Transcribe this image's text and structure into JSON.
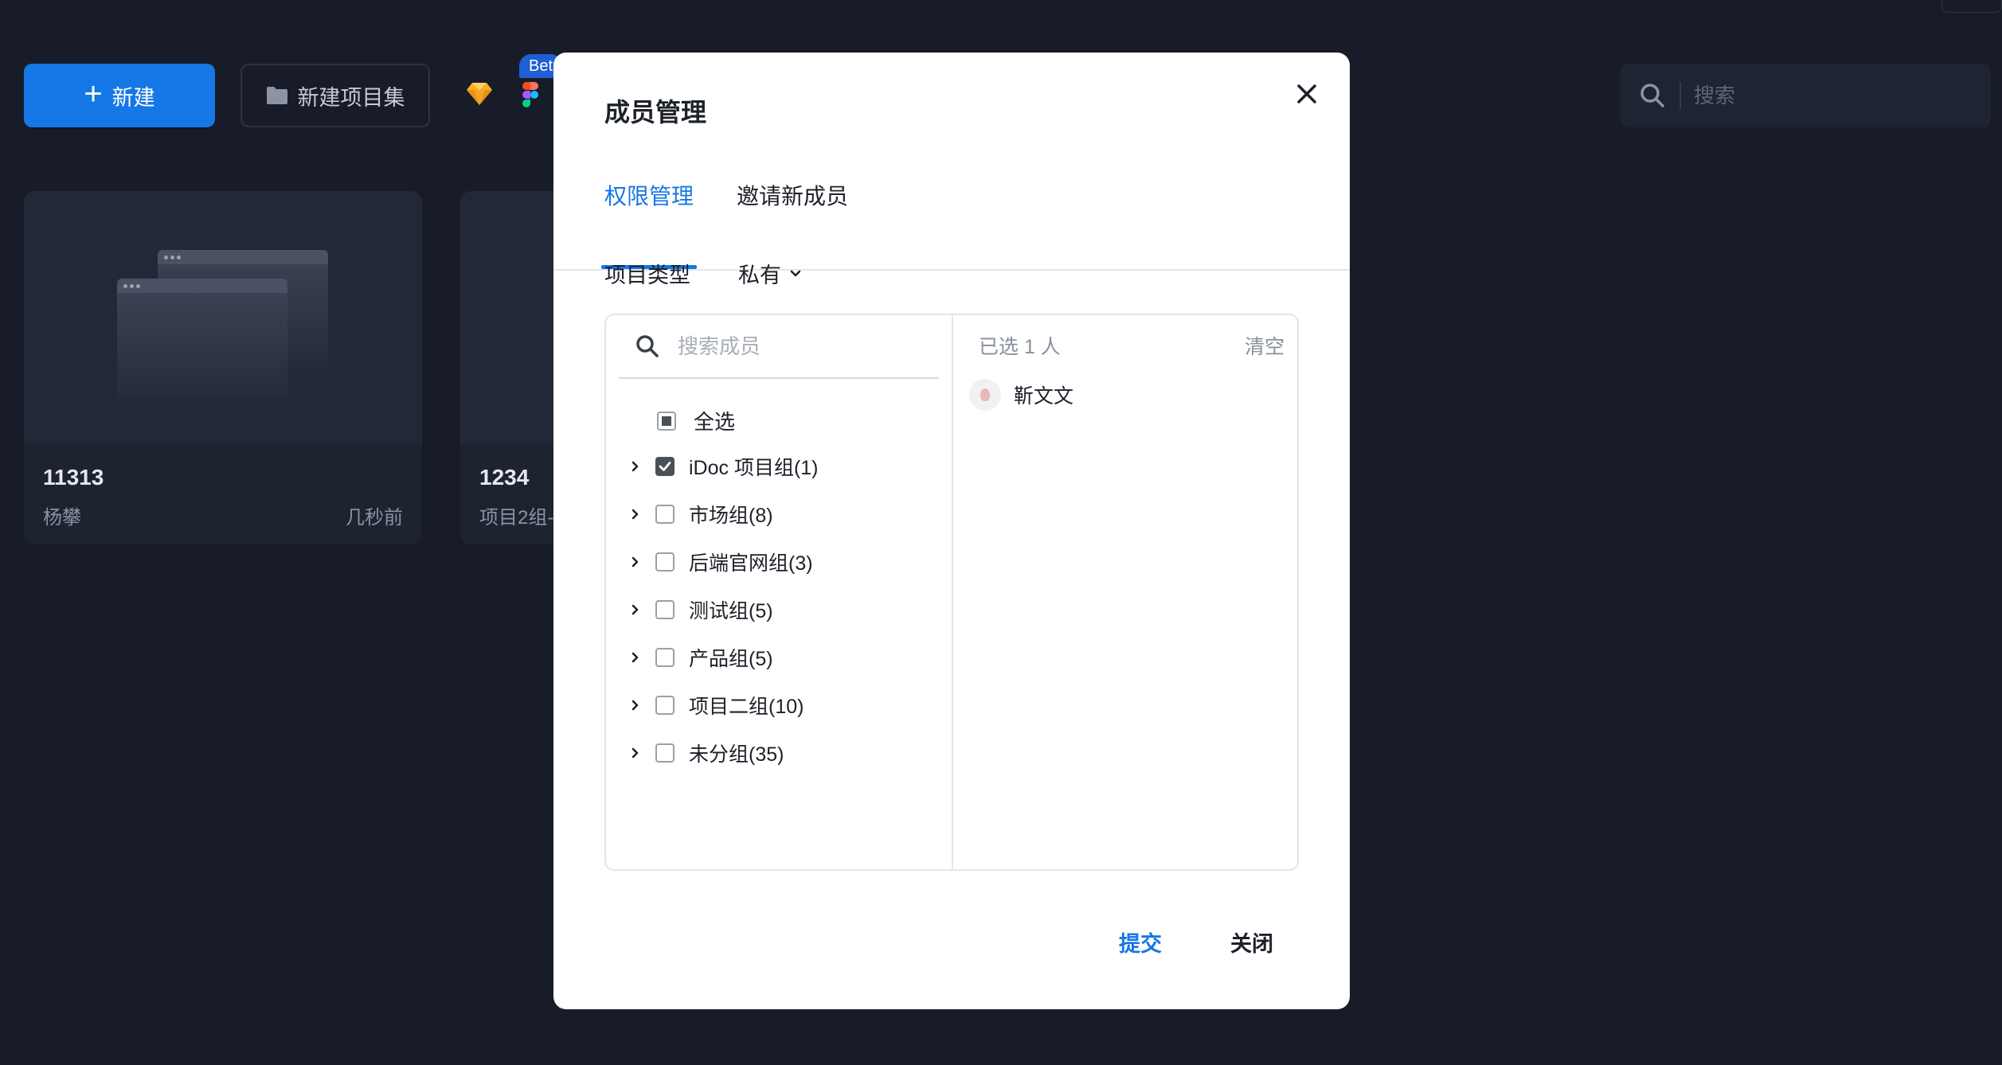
{
  "toolbar": {
    "new_label": "新建",
    "new_folder_label": "新建项目集",
    "beta_badge": "Bet",
    "search_placeholder": "搜索"
  },
  "projects": [
    {
      "name": "11313",
      "owner": "杨攀",
      "time": "几秒前"
    },
    {
      "name": "1234",
      "owner": "项目2组-",
      "time": ""
    }
  ],
  "modal": {
    "title": "成员管理",
    "tabs": [
      {
        "label": "权限管理",
        "active": true
      },
      {
        "label": "邀请新成员",
        "active": false
      }
    ],
    "project_type_label": "项目类型",
    "project_type_value": "私有",
    "member_search_placeholder": "搜索成员",
    "select_all_label": "全选",
    "groups": [
      {
        "label": "iDoc 项目组(1)",
        "checked": true
      },
      {
        "label": "市场组(8)",
        "checked": false
      },
      {
        "label": "后端官网组(3)",
        "checked": false
      },
      {
        "label": "测试组(5)",
        "checked": false
      },
      {
        "label": "产品组(5)",
        "checked": false
      },
      {
        "label": "项目二组(10)",
        "checked": false
      },
      {
        "label": "未分组(35)",
        "checked": false
      }
    ],
    "selected_count_text": "已选 1 人",
    "clear_label": "清空",
    "selected_members": [
      {
        "name": "靳文文"
      }
    ],
    "submit_label": "提交",
    "close_label": "关闭"
  },
  "colors": {
    "accent": "#1677e6",
    "background": "#171c28",
    "beta": "#1f5fd6"
  },
  "icons": [
    "plus-icon",
    "folder-icon",
    "sketch-icon",
    "figma-icon",
    "search-icon",
    "close-icon",
    "chevron-down-icon",
    "chevron-right-icon",
    "check-icon"
  ]
}
